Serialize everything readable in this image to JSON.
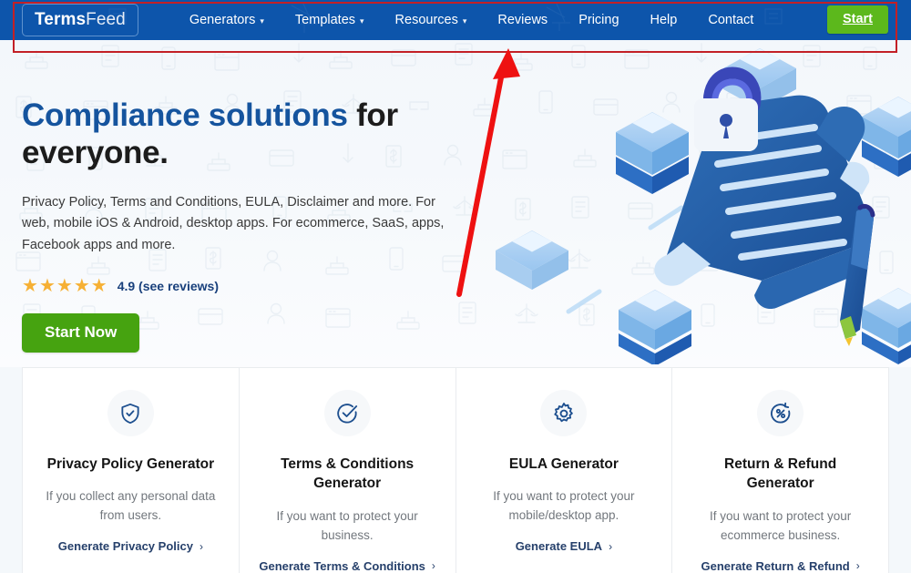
{
  "navbar": {
    "logo": {
      "bold": "Terms",
      "light": "Feed",
      "name": "TermsFeed"
    },
    "links": [
      {
        "label": "Generators",
        "has_caret": true
      },
      {
        "label": "Templates",
        "has_caret": true
      },
      {
        "label": "Resources",
        "has_caret": true
      },
      {
        "label": "Reviews",
        "has_caret": false
      },
      {
        "label": "Pricing",
        "has_caret": false
      },
      {
        "label": "Help",
        "has_caret": false
      },
      {
        "label": "Contact",
        "has_caret": false
      }
    ],
    "start_button": "Start",
    "bg_color": "#0d55ab",
    "start_color": "#5cb81c"
  },
  "hero": {
    "title_highlight": "Compliance solutions",
    "title_rest": " for everyone.",
    "subtitle": "Privacy Policy, Terms and Conditions, EULA, Disclaimer and more. For web, mobile iOS & Android, desktop apps. For ecommerce, SaaS, apps, Facebook apps and more.",
    "rating_value": "4.9",
    "rating_link": "(see reviews)",
    "rating_text": "4.9 (see reviews)",
    "stars": 5,
    "star_color": "#f6b034",
    "cta": "Start Now",
    "cta_color": "#46a310",
    "title_color": "#15549e"
  },
  "cards": [
    {
      "icon": "shield-check-icon",
      "title": "Privacy Policy Generator",
      "desc": "If you collect any personal data from users.",
      "link": "Generate Privacy Policy",
      "chevron": "›"
    },
    {
      "icon": "circle-check-icon",
      "title": "Terms & Conditions Generator",
      "desc": "If you want to protect your business.",
      "link": "Generate Terms & Conditions",
      "chevron": "›"
    },
    {
      "icon": "gear-icon",
      "title": "EULA Generator",
      "desc": "If you want to protect your mobile/desktop app.",
      "link": "Generate EULA",
      "chevron": "›"
    },
    {
      "icon": "refund-circle-icon",
      "title": "Return & Refund Generator",
      "desc": "If you want to protect your ecommerce business.",
      "link": "Generate Return & Refund",
      "chevron": "›"
    }
  ],
  "annotations": {
    "highlight_color": "#c32026",
    "arrow_color": "#ee1111",
    "highlight_target": "navbar",
    "arrow_points_to": "navbar"
  }
}
